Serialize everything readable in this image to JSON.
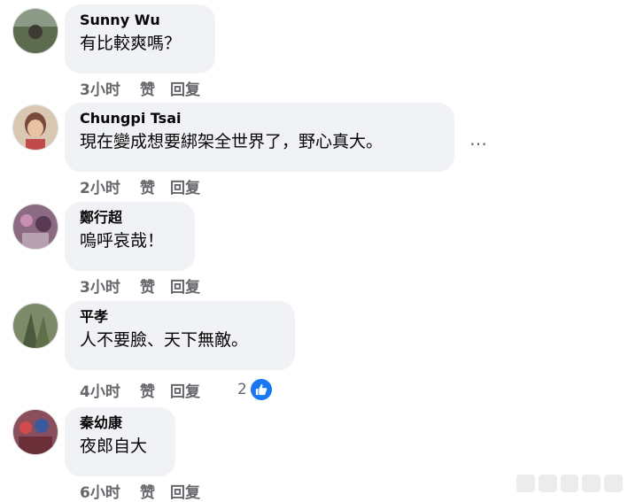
{
  "comments": [
    {
      "author": "Sunny Wu",
      "text": "有比較爽嗎？",
      "time": "3小时",
      "like": "赞",
      "reply": "回复"
    },
    {
      "author": "Chungpi Tsai",
      "text": "現在變成想要綁架全世界了，野心真大。",
      "time": "2小时",
      "like": "赞",
      "reply": "回复"
    },
    {
      "author": "鄭行超",
      "text": "嗚呼哀哉！",
      "time": "3小时",
      "like": "赞",
      "reply": "回复"
    },
    {
      "author": "平孝",
      "text": "人不要臉、天下無敵。",
      "time": "4小时",
      "like": "赞",
      "reply": "回复",
      "reaction_count": "2"
    },
    {
      "author": "秦幼康",
      "text": "夜郎自大",
      "time": "6小时",
      "like": "赞",
      "reply": "回复"
    }
  ],
  "more_menu": "…",
  "colors": {
    "bubble": "#f0f2f5",
    "meta": "#65676b",
    "like_blue": "#1877f2"
  }
}
